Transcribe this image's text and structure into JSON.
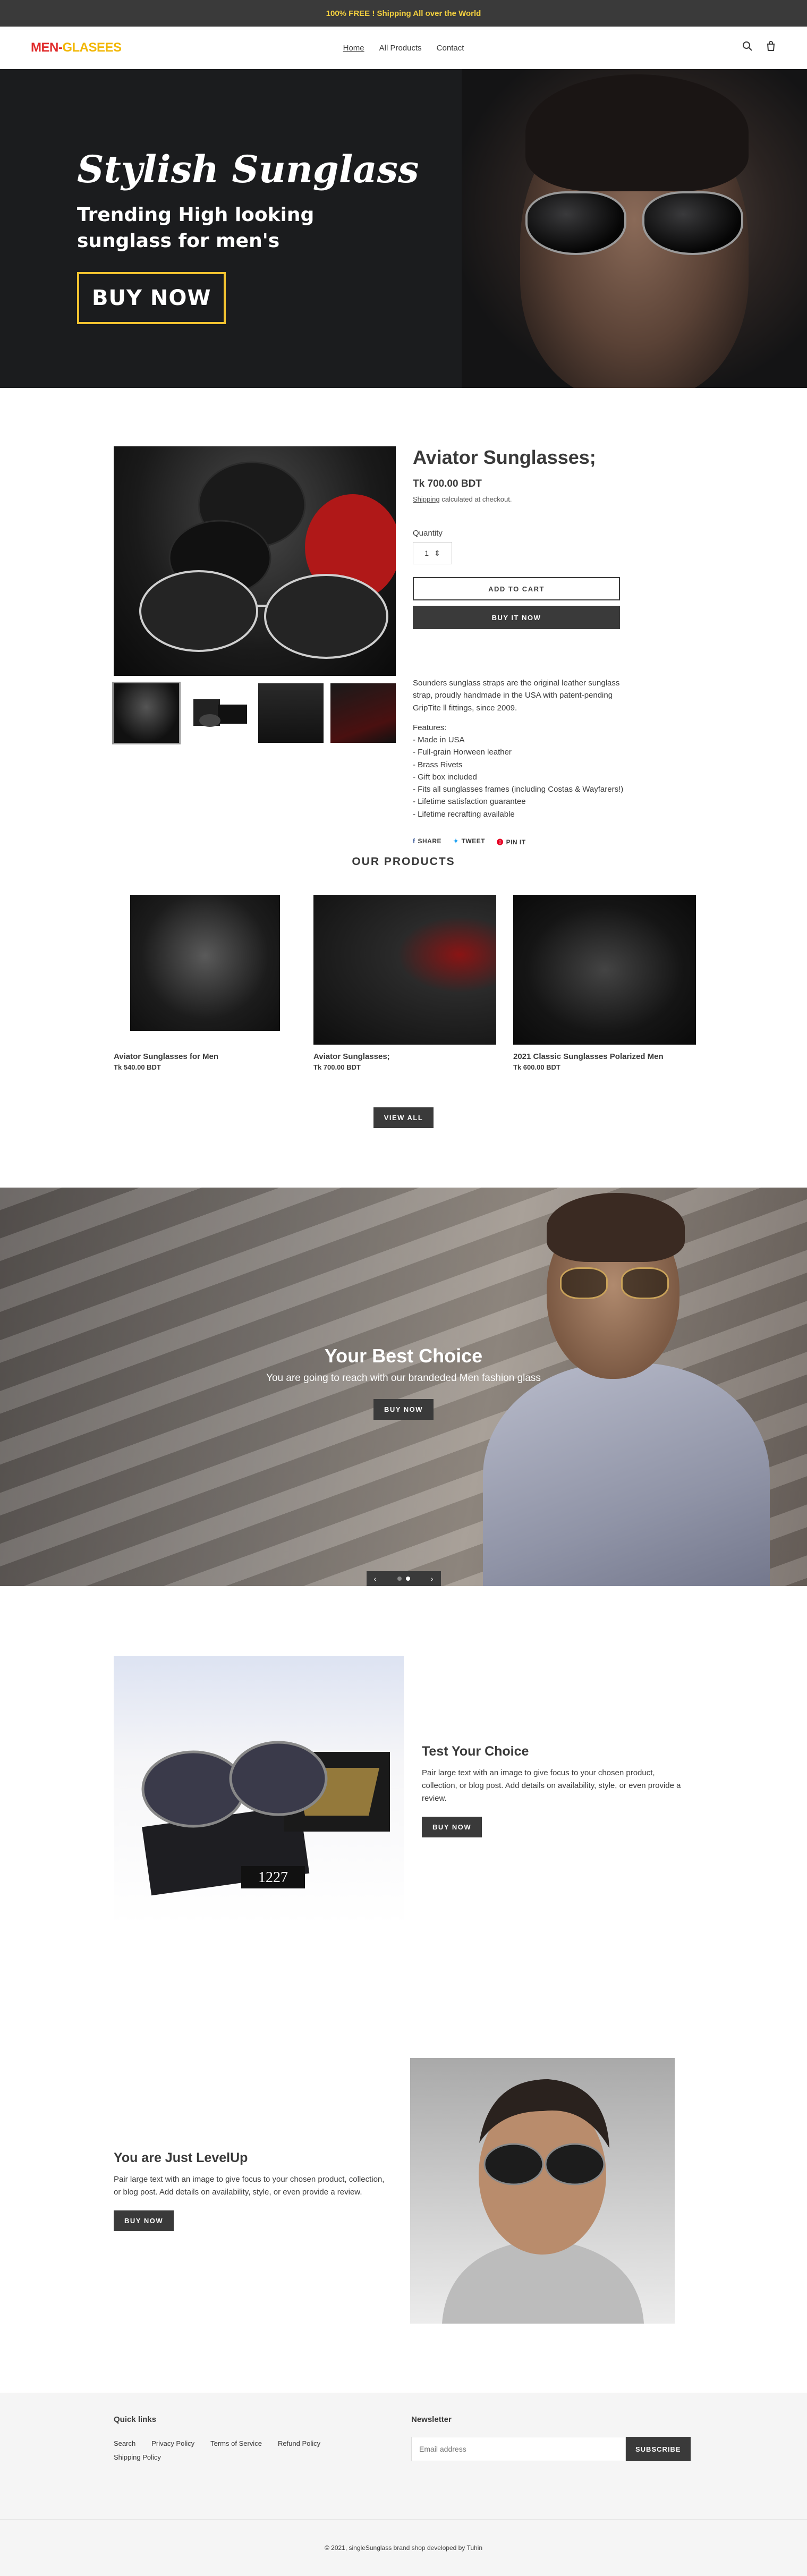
{
  "announcement": {
    "text": "100% FREE ! Shipping All over the World"
  },
  "header": {
    "logo_part1": "MEN-",
    "logo_part2": "GLASEES",
    "nav": [
      "Home",
      "All Products",
      "Contact"
    ],
    "icons": [
      "search-icon",
      "cart-icon"
    ]
  },
  "hero": {
    "title": "Stylish Sunglass",
    "subtitle": "Trending High looking sunglass for men's",
    "button": "BUY NOW"
  },
  "product": {
    "title": "Aviator Sunglasses;",
    "price": "Tk 700.00 BDT",
    "shipping_link": "Shipping",
    "shipping_rest": " calculated at checkout.",
    "quantity_label": "Quantity",
    "quantity_value": "1",
    "add_to_cart": "ADD TO CART",
    "buy_now": "BUY IT NOW",
    "description": "Sounders sunglass straps are the original leather sunglass strap, proudly handmade in the USA with patent-pending GripTite ll fittings, since 2009.",
    "features_title": "Features:",
    "features": [
      "- Made in USA",
      "- Full-grain Horween leather",
      "- Brass Rivets",
      "- Gift box included",
      "- Fits all sunglasses frames (including Costas & Wayfarers!)",
      "- Lifetime satisfaction guarantee",
      "- Lifetime recrafting available"
    ],
    "share": [
      "SHARE",
      "TWEET",
      "PIN IT"
    ]
  },
  "featured": {
    "title": "OUR PRODUCTS",
    "items": [
      {
        "name": "Aviator Sunglasses for Men",
        "price": "Tk 540.00 BDT"
      },
      {
        "name": "Aviator Sunglasses;",
        "price": "Tk 700.00 BDT"
      },
      {
        "name": "2021 Classic Sunglasses Polarized Men",
        "price": "Tk 600.00 BDT"
      }
    ],
    "view_all": "VIEW ALL"
  },
  "slideshow": {
    "title": "Your Best Choice",
    "subtitle": "You are going to reach with our brandeded Men fashion glass",
    "button": "BUY NOW",
    "current_slide": 2,
    "total_slides": 2
  },
  "image_text_1": {
    "title": "Test Your Choice",
    "body": "Pair large text with an image to give focus to your chosen product, collection, or blog post. Add details on availability, style, or even provide a review.",
    "button": "BUY NOW",
    "tag": "1227"
  },
  "image_text_2": {
    "title": "You are Just LevelUp",
    "body": "Pair large text with an image to give focus to your chosen product, collection, or blog post. Add details on availability, style, or even provide a review.",
    "button": "BUY NOW"
  },
  "footer": {
    "quick_links_title": "Quick links",
    "links": [
      "Search",
      "Privacy Policy",
      "Terms of Service",
      "Refund Policy",
      "Shipping Policy"
    ],
    "newsletter_title": "Newsletter",
    "email_placeholder": "Email address",
    "subscribe": "SUBSCRIBE",
    "copyright": "© 2021, singleSunglass brand shop developed by Tuhin"
  },
  "colors": {
    "dark": "#3a3a3a",
    "accent_yellow": "#f4d03f",
    "logo_red": "#e02a2a",
    "logo_yellow": "#f2b705"
  }
}
